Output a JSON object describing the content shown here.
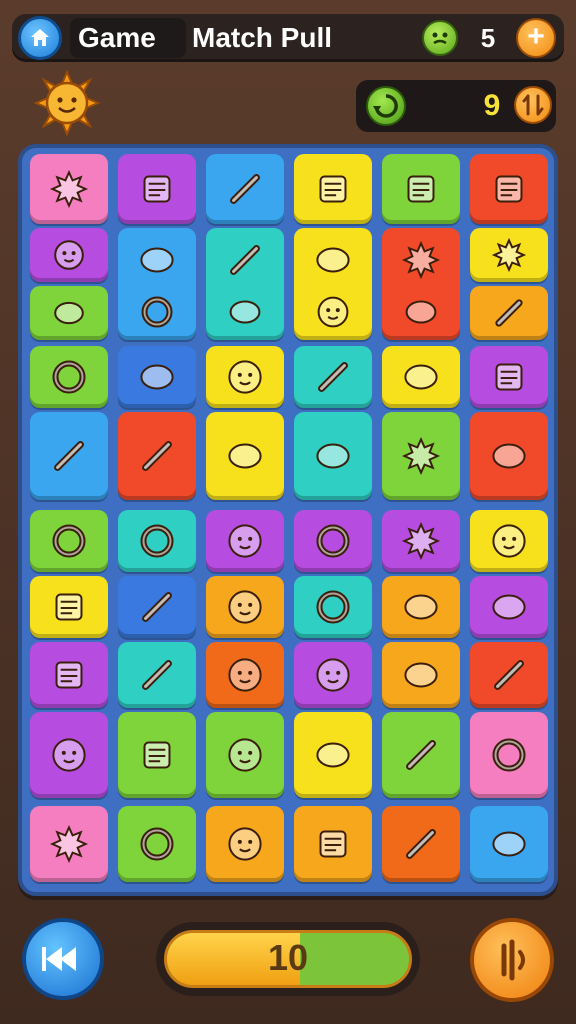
{
  "header": {
    "title_part1": "Game",
    "title_part2": "Match Pull",
    "coins": "5",
    "plus_label": "+"
  },
  "score": {
    "value": "9",
    "button_icon": "swap-icon"
  },
  "board": {
    "columns": 6,
    "tiles": [
      {
        "id": "t1",
        "color": "#f47ec0",
        "icon": "star-creature-icon"
      },
      {
        "id": "t2",
        "color": "#b64de0",
        "icon": "calculator-icon"
      },
      {
        "id": "t3",
        "color": "#3aa6f0",
        "icon": "lipstick-icon"
      },
      {
        "id": "t4",
        "color": "#f7e11c",
        "icon": "box-icon"
      },
      {
        "id": "t5",
        "color": "#7ed43a",
        "icon": "newspaper-icon"
      },
      {
        "id": "t6",
        "color": "#f04a2a",
        "icon": "document-icon"
      },
      {
        "id": "t7",
        "color": "#b64de0",
        "icon": "cat-face-icon"
      },
      {
        "id": "t8",
        "color": "#3aa6f0",
        "icon": "bowl-icon"
      },
      {
        "id": "t9",
        "color": "#2fcfc3",
        "icon": "scissors-icon"
      },
      {
        "id": "t10",
        "color": "#f7e11c",
        "icon": "carrot-icon"
      },
      {
        "id": "t11",
        "color": "#f04a2a",
        "icon": "sun-burst-icon"
      },
      {
        "id": "t12",
        "color": "#f7e11c",
        "icon": "leaf-icon"
      },
      {
        "id": "t13",
        "color": "#7ed43a",
        "icon": "heart-flag-icon"
      },
      {
        "id": "t14",
        "color": "#3aa6f0",
        "icon": "ring-icon"
      },
      {
        "id": "t15",
        "color": "#2fcfc3",
        "icon": "ball-icon"
      },
      {
        "id": "t16",
        "color": "#f7e11c",
        "icon": "bear-face-icon"
      },
      {
        "id": "t17",
        "color": "#f04a2a",
        "icon": "dog-icon"
      },
      {
        "id": "t18",
        "color": "#f7a71c",
        "icon": "crossed-sticks-icon"
      },
      {
        "id": "t19",
        "color": "#7ed43a",
        "icon": "donut-icon"
      },
      {
        "id": "t20",
        "color": "#3a7ae0",
        "icon": "shoe-icon"
      },
      {
        "id": "t21",
        "color": "#f7e11c",
        "icon": "cookie-icon"
      },
      {
        "id": "t22",
        "color": "#2fcfc3",
        "icon": "pencil-icon"
      },
      {
        "id": "t23",
        "color": "#f7e11c",
        "icon": "palette-icon"
      },
      {
        "id": "t24",
        "color": "#b64de0",
        "icon": "radio-icon"
      },
      {
        "id": "t25",
        "color": "#3aa6f0",
        "icon": "crossed-tools-icon"
      },
      {
        "id": "t26",
        "color": "#f04a2a",
        "icon": "wand-icon"
      },
      {
        "id": "t27",
        "color": "#f7e11c",
        "icon": "stripe-ball-icon"
      },
      {
        "id": "t28",
        "color": "#2fcfc3",
        "icon": "toy-icon"
      },
      {
        "id": "t29",
        "color": "#7ed43a",
        "icon": "gear-icon"
      },
      {
        "id": "t30",
        "color": "#f04a2a",
        "icon": "slingshot-icon"
      },
      {
        "id": "t31",
        "color": "#7ed43a",
        "icon": "snail-icon"
      },
      {
        "id": "t32",
        "color": "#2fcfc3",
        "icon": "whistle-icon"
      },
      {
        "id": "t33",
        "color": "#b64de0",
        "icon": "purple-face-icon"
      },
      {
        "id": "t34",
        "color": "#b64de0",
        "icon": "orbit-icon"
      },
      {
        "id": "t35",
        "color": "#b64de0",
        "icon": "splash-icon"
      },
      {
        "id": "t36",
        "color": "#f7e11c",
        "icon": "blue-face-icon"
      },
      {
        "id": "t37",
        "color": "#f7e11c",
        "icon": "cube-icon"
      },
      {
        "id": "t38",
        "color": "#3a7ae0",
        "icon": "crayon-icon"
      },
      {
        "id": "t39",
        "color": "#f7a71c",
        "icon": "cat-head-icon"
      },
      {
        "id": "t40",
        "color": "#2fcfc3",
        "icon": "lollipop-icon"
      },
      {
        "id": "t41",
        "color": "#f7a71c",
        "icon": "drill-icon"
      },
      {
        "id": "t42",
        "color": "#b64de0",
        "icon": "cone-icon"
      },
      {
        "id": "t43",
        "color": "#b64de0",
        "icon": "battery-icon"
      },
      {
        "id": "t44",
        "color": "#2fcfc3",
        "icon": "knife-icon"
      },
      {
        "id": "t45",
        "color": "#f06a1a",
        "icon": "devil-face-icon"
      },
      {
        "id": "t46",
        "color": "#b64de0",
        "icon": "pig-face-icon"
      },
      {
        "id": "t47",
        "color": "#f7a71c",
        "icon": "blue-ball-icon"
      },
      {
        "id": "t48",
        "color": "#f04a2a",
        "icon": "pin-icon"
      },
      {
        "id": "t49",
        "color": "#b64de0",
        "icon": "flower-face-icon"
      },
      {
        "id": "t50",
        "color": "#7ed43a",
        "icon": "dice-icon"
      },
      {
        "id": "t51",
        "color": "#7ed43a",
        "icon": "frog-face-icon"
      },
      {
        "id": "t52",
        "color": "#f7e11c",
        "icon": "strawberry-icon"
      },
      {
        "id": "t53",
        "color": "#7ed43a",
        "icon": "brush-icon"
      },
      {
        "id": "t54",
        "color": "#f47ec0",
        "icon": "spiral-shell-icon"
      },
      {
        "id": "t55",
        "color": "#f47ec0",
        "icon": "flower-icon"
      },
      {
        "id": "t56",
        "color": "#7ed43a",
        "icon": "hoop-icon"
      },
      {
        "id": "t57",
        "color": "#f7a71c",
        "icon": "glasses-face-icon"
      },
      {
        "id": "t58",
        "color": "#f7a71c",
        "icon": "wallet-icon"
      },
      {
        "id": "t59",
        "color": "#f06a1a",
        "icon": "paintbrush-icon"
      },
      {
        "id": "t60",
        "color": "#3aa6f0",
        "icon": "potion-icon"
      }
    ]
  },
  "footer": {
    "progress_value": "10",
    "progress_fraction": 0.55,
    "back_icon": "rewind-icon",
    "sound_icon": "sound-icon"
  },
  "colors": {
    "accent_blue": "#1d7ed8",
    "accent_orange": "#f28a12",
    "accent_green": "#5ca51b",
    "board_bg": "#3e6fc2",
    "frame": "#4a3226"
  }
}
